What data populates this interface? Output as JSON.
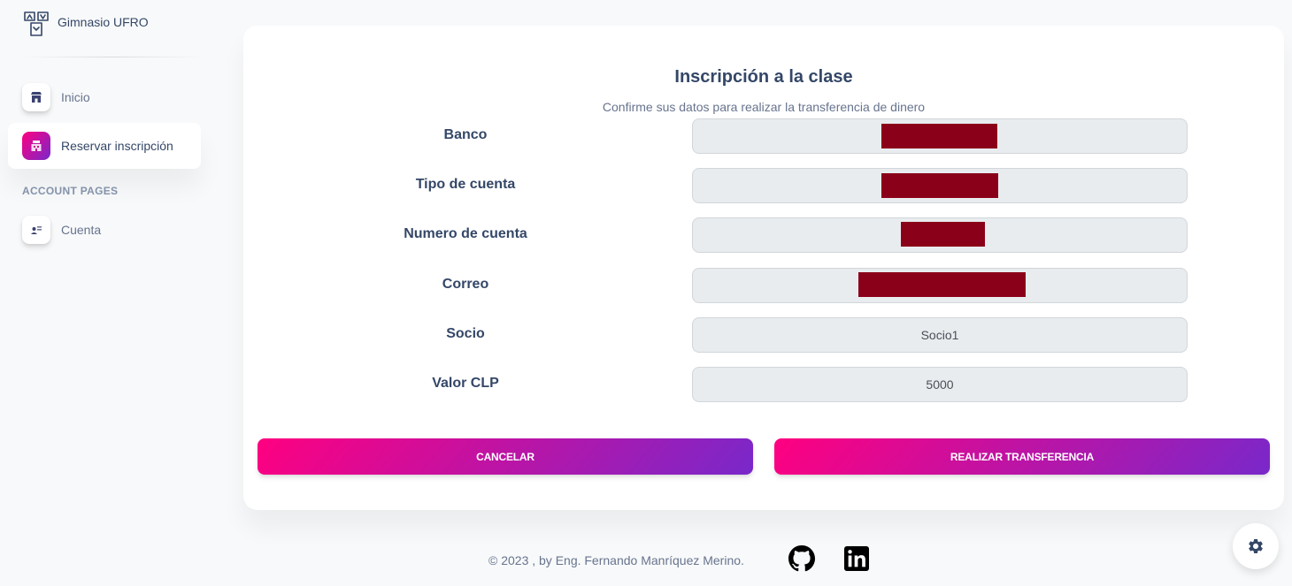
{
  "brand": {
    "name": "Gimnasio UFRO"
  },
  "sidebar": {
    "items": [
      {
        "label": "Inicio",
        "icon": "shop-icon",
        "active": false
      },
      {
        "label": "Reservar inscripción",
        "icon": "office-icon",
        "active": true
      }
    ],
    "section_heading": "ACCOUNT PAGES",
    "account_items": [
      {
        "label": "Cuenta",
        "icon": "user-card-icon",
        "active": false
      }
    ]
  },
  "card": {
    "title": "Inscripción a la clase",
    "subtitle": "Confirme sus datos para realizar la transferencia de dinero",
    "fields": [
      {
        "label": "Banco",
        "value": "",
        "redacted": true
      },
      {
        "label": "Tipo de cuenta",
        "value": "",
        "redacted": true
      },
      {
        "label": "Numero de cuenta",
        "value": "",
        "redacted": true
      },
      {
        "label": "Correo",
        "value": "",
        "redacted": true
      },
      {
        "label": "Socio",
        "value": "Socio1",
        "redacted": false
      },
      {
        "label": "Valor CLP",
        "value": "5000",
        "redacted": false
      }
    ],
    "cancel_label": "CANCELAR",
    "submit_label": "REALIZAR TRANSFERENCIA"
  },
  "footer": {
    "text": "© 2023 , by Eng. Fernando Manríquez Merino.",
    "icons": [
      "github-icon",
      "linkedin-icon"
    ]
  },
  "settings": {
    "icon": "gear-icon"
  },
  "colors": {
    "accent_start": "#ff0080",
    "accent_end": "#7928ca",
    "redaction": "#8b0019",
    "text_primary": "#344767",
    "text_secondary": "#67748e"
  }
}
